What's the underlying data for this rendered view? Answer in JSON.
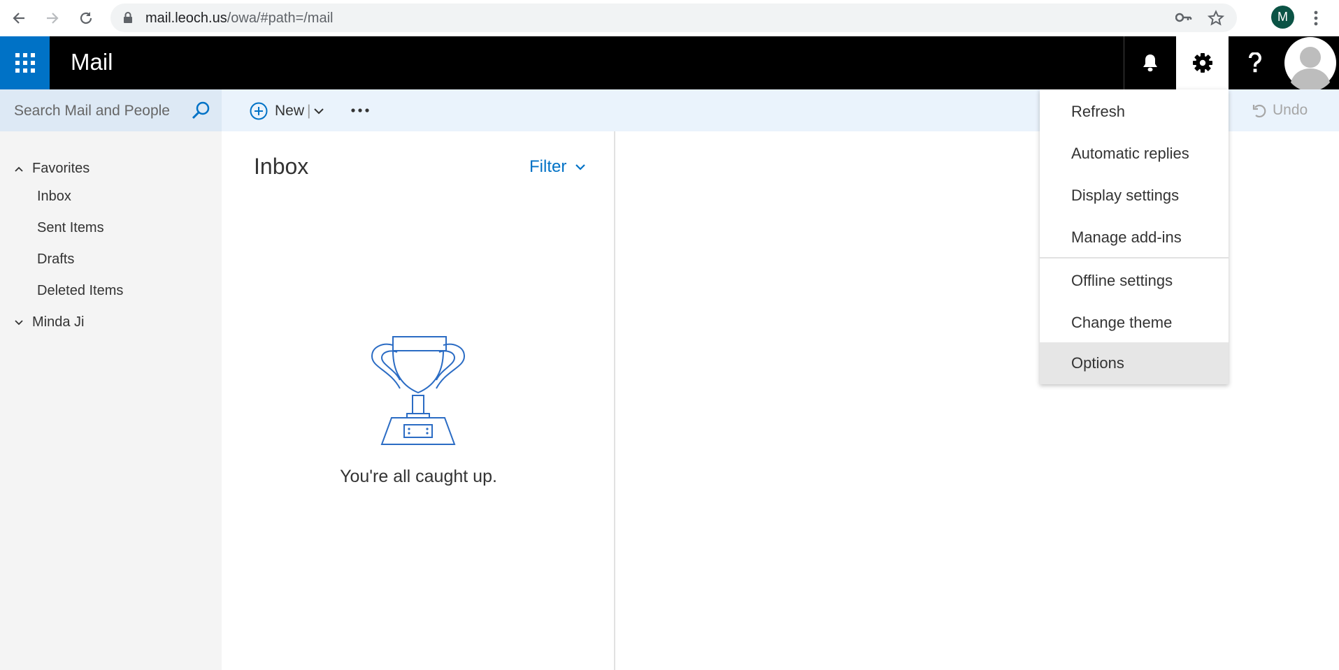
{
  "browser": {
    "url_host": "mail.leoch.us",
    "url_path": "/owa/#path=/mail",
    "profile_initial": "M"
  },
  "suitebar": {
    "app_name": "Mail",
    "accent_color": "#0072c6"
  },
  "command_bar": {
    "search_placeholder": "Search Mail and People",
    "new_label": "New",
    "new_separator": "|",
    "undo_label": "Undo"
  },
  "leftnav": {
    "favorites_label": "Favorites",
    "favorites": [
      "Inbox",
      "Sent Items",
      "Drafts",
      "Deleted Items"
    ],
    "account_label": "Minda Ji"
  },
  "message_list": {
    "title": "Inbox",
    "filter_label": "Filter",
    "empty_message": "You're all caught up."
  },
  "settings_menu": {
    "items": [
      "Refresh",
      "Automatic replies",
      "Display settings",
      "Manage add-ins",
      "Offline settings",
      "Change theme",
      "Options"
    ],
    "active_item": "Options"
  }
}
